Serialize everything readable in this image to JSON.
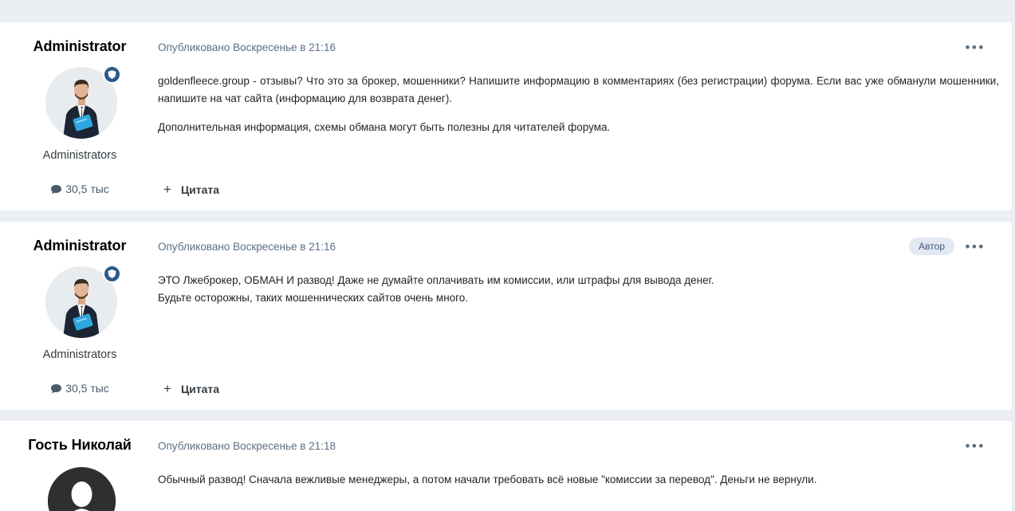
{
  "posts": [
    {
      "author": "Administrator",
      "meta": "Опубликовано Воскресенье в 21:16",
      "group": "Administrators",
      "post_count": "30,5 тыс",
      "paragraphs": [
        "goldenfleece.group - отзывы? Что это за брокер, мошенники? Напишите информацию в комментариях (без регистрации) форума. Если вас уже обманули мошенники, напишите на чат сайта (информацию для возврата денег).",
        "Дополнительная информация, схемы обмана могут быть полезны для читателей форума."
      ],
      "quote_label": "Цитата",
      "menu": "•••"
    },
    {
      "author": "Administrator",
      "meta": "Опубликовано Воскресенье в 21:16",
      "badge": "Автор",
      "group": "Administrators",
      "post_count": "30,5 тыс",
      "lines": [
        "ЭТО Лжеброкер, ОБМАН И развод! Даже не думайте оплачивать им комиссии, или штрафы для вывода денег.",
        "Будьте осторожны, таких мошеннических сайтов очень много."
      ],
      "quote_label": "Цитата",
      "menu": "•••"
    },
    {
      "author": "Гость Николай",
      "meta": "Опубликовано Воскресенье в 21:18",
      "lines": [
        "Обычный развод! Сначала вежливые менеджеры, а потом начали требовать всё новые \"комиссии за перевод\". Деньги не вернули."
      ],
      "menu": "•••"
    }
  ],
  "icons": {
    "comment": "comment-icon",
    "shield": "shield-icon",
    "plus": "+",
    "dots": "ellipsis-icon"
  },
  "colors": {
    "page_bg": "#ebeef3",
    "card_bg": "#ffffff",
    "meta": "#5c6f82",
    "badge_bg": "#e3e9f2",
    "shield_badge": "#2a5b8a"
  }
}
